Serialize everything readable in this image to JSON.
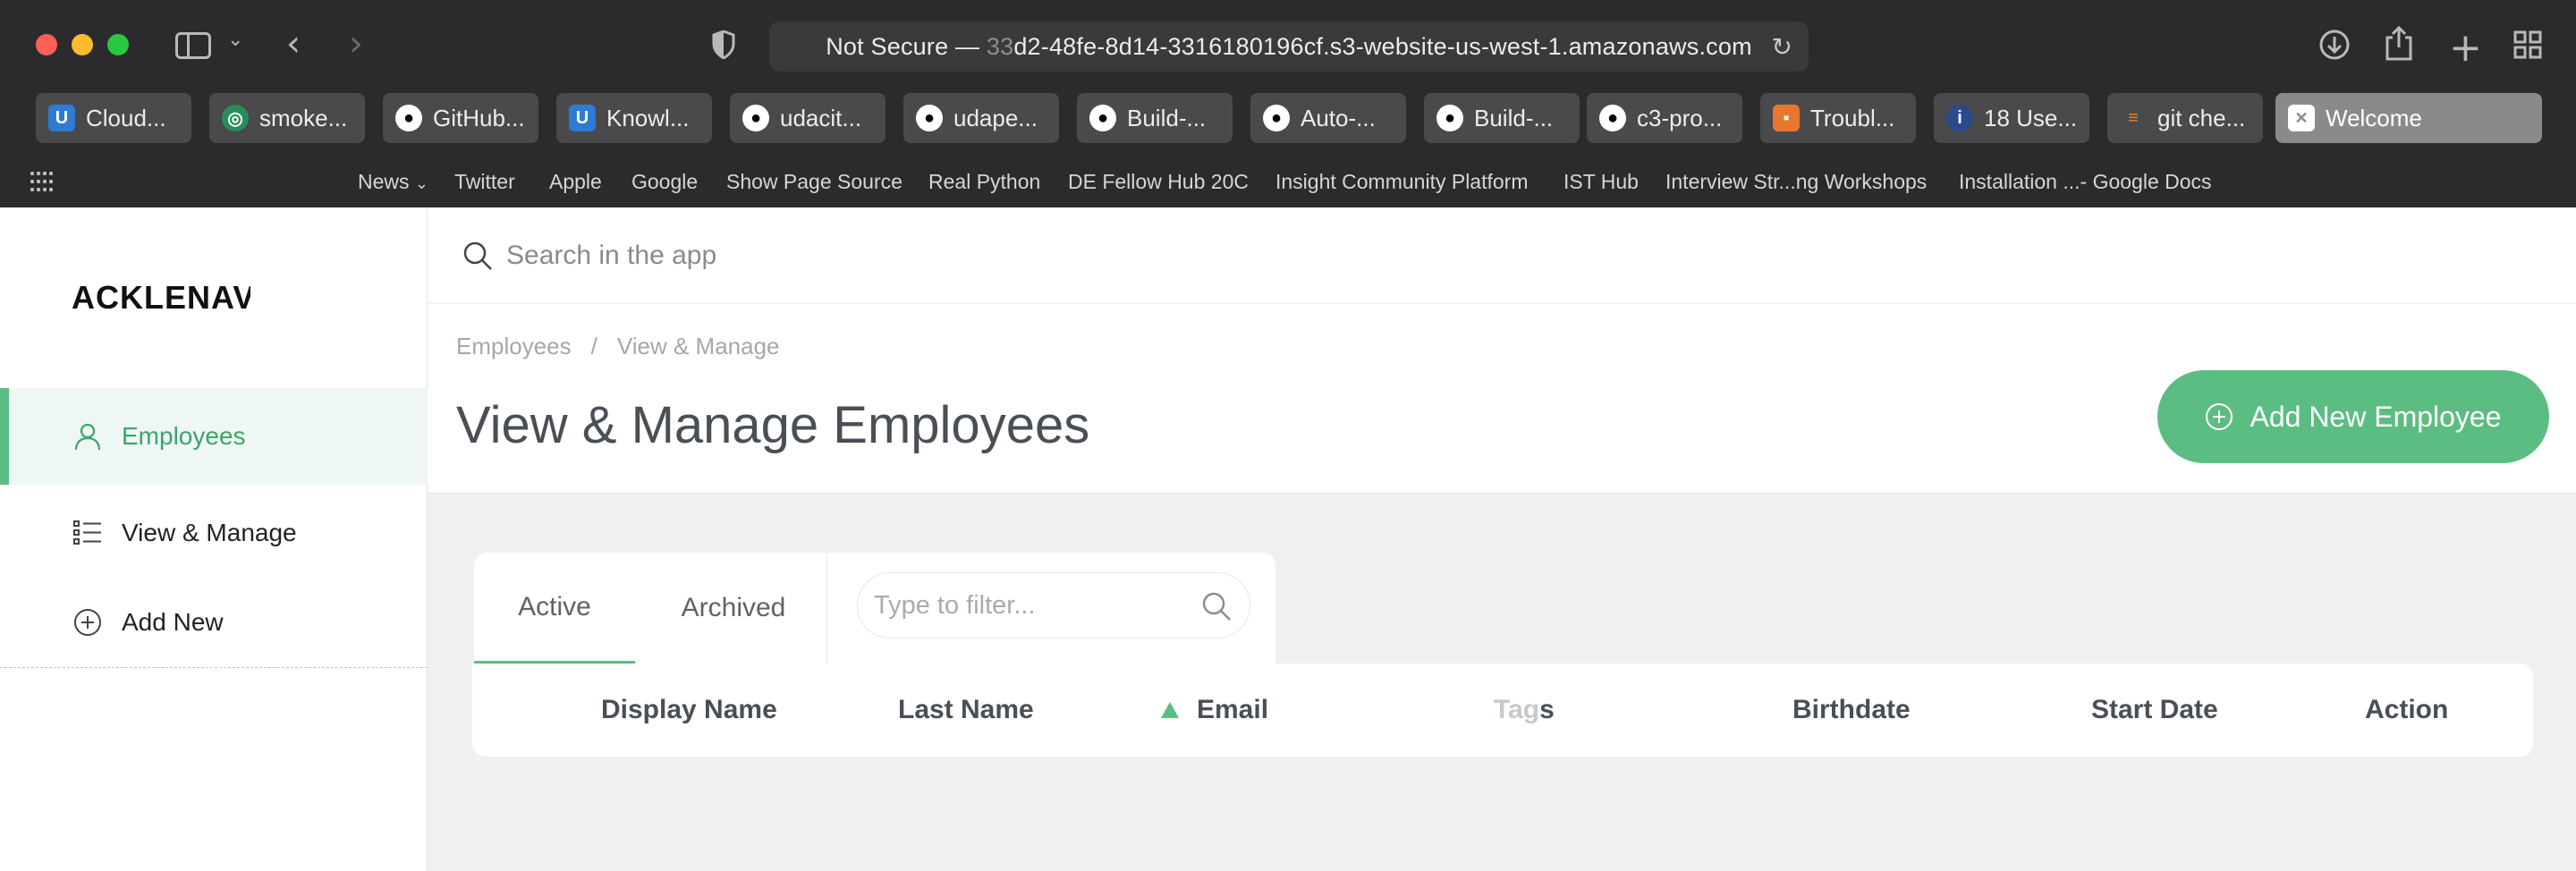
{
  "browser": {
    "url_prefix": "Not Secure — ",
    "url_faded": "33",
    "url_rest": "d2-48fe-8d14-3316180196cf.s3-website-us-west-1.amazonaws.com",
    "tabs": [
      {
        "label": "Cloud...",
        "icon": "udacity-icon"
      },
      {
        "label": "smoke...",
        "icon": "smoke-icon"
      },
      {
        "label": "GitHub...",
        "icon": "github-icon"
      },
      {
        "label": "Knowl...",
        "icon": "udacity-icon"
      },
      {
        "label": "udacit...",
        "icon": "github-icon"
      },
      {
        "label": "udape...",
        "icon": "github-icon"
      },
      {
        "label": "Build-...",
        "icon": "github-icon"
      },
      {
        "label": "Auto-...",
        "icon": "github-icon"
      },
      {
        "label": "Build-...",
        "icon": "github-icon"
      },
      {
        "label": "c3-pro...",
        "icon": "github-icon"
      },
      {
        "label": "Troubl...",
        "icon": "aws-icon"
      },
      {
        "label": "18 Use...",
        "icon": "info-icon"
      },
      {
        "label": "git che...",
        "icon": "stackoverflow-icon"
      },
      {
        "label": "Welcome",
        "icon": "close-icon",
        "active": true
      }
    ],
    "bookmarks": [
      "News",
      "Twitter",
      "Apple",
      "Google",
      "Show Page Source",
      "Real Python",
      "DE Fellow Hub 20C",
      "Insight Community Platform",
      "IST Hub",
      "Interview Str...ng Workshops",
      "Installation ...- Google Docs"
    ]
  },
  "app": {
    "logo_text": "ACKLENAV",
    "nav": [
      {
        "label": "Employees",
        "icon": "user-icon",
        "active": true
      },
      {
        "label": "View & Manage",
        "icon": "list-icon"
      },
      {
        "label": "Add New",
        "icon": "plus-circle-icon"
      }
    ],
    "search": {
      "placeholder": "Search in the app"
    },
    "breadcrumb": {
      "root": "Employees",
      "sep": "/",
      "current": "View & Manage"
    },
    "title": "View & Manage Employees",
    "add_button_label": "Add New Employee",
    "tabs": {
      "active": "Active",
      "archived": "Archived"
    },
    "filter": {
      "placeholder": "Type to filter..."
    },
    "columns": {
      "display_name": "Display Name",
      "last_name": "Last Name",
      "email": "Email",
      "tags_muted": "Tag",
      "tags_end": "s",
      "birthdate": "Birthdate",
      "start_date": "Start Date",
      "action": "Action"
    },
    "colors": {
      "accent": "#5cbd83",
      "accent_dark": "#3ca46d"
    }
  }
}
